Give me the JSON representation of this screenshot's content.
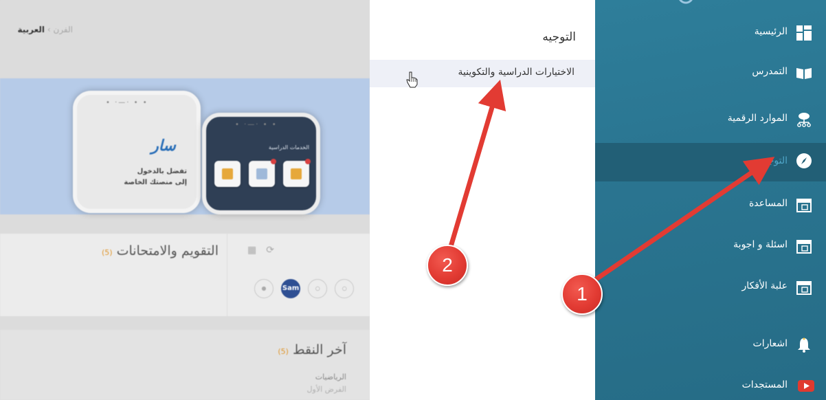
{
  "background": {
    "breadcrumb": {
      "current": "العربية",
      "separator": "›",
      "next": "الفرن"
    },
    "hero": {
      "notch_dots": "• ·—· • •",
      "logo": "سار",
      "text_line1": "تفضل بالدخول",
      "text_line2": "إلى منصتك الخاصة",
      "services_title": "الخدمات الدراسية"
    },
    "evaluation_card": {
      "title": "التقويم والامتحانات",
      "count": "(5)",
      "avatar_label": "Sam"
    },
    "points_card": {
      "title": "آخر النقط",
      "count": "(5)",
      "subject": "الرياضيات",
      "task": "الفرض الأول"
    }
  },
  "submenu": {
    "title": "التوجيه",
    "items": [
      {
        "label": "الاختيارات الدراسية والتكوينية"
      }
    ]
  },
  "sidebar": {
    "items": [
      {
        "label": "الرئيسية",
        "icon": "dashboard-icon"
      },
      {
        "label": "التمدرس",
        "icon": "book-icon"
      },
      {
        "label": "الموارد الرقمية",
        "icon": "cloud-network-icon"
      },
      {
        "label": "التوجيه",
        "icon": "compass-icon",
        "active": true
      },
      {
        "label": "المساعدة",
        "icon": "calendar-icon"
      },
      {
        "label": "اسئلة و اجوبة",
        "icon": "calendar-icon"
      },
      {
        "label": "علبة الأفكار",
        "icon": "calendar-icon"
      },
      {
        "label": "اشعارات",
        "icon": "bell-icon"
      },
      {
        "label": "المستجدات",
        "icon": "youtube-icon"
      }
    ]
  },
  "annotations": {
    "marker_1": "1",
    "marker_2": "2",
    "color": "#e23b33"
  },
  "colors": {
    "sidebar_bg": "#2a7591",
    "sidebar_active": "#225f76",
    "active_label": "#4fa6c8",
    "submenu_hover": "#eef0f7"
  }
}
